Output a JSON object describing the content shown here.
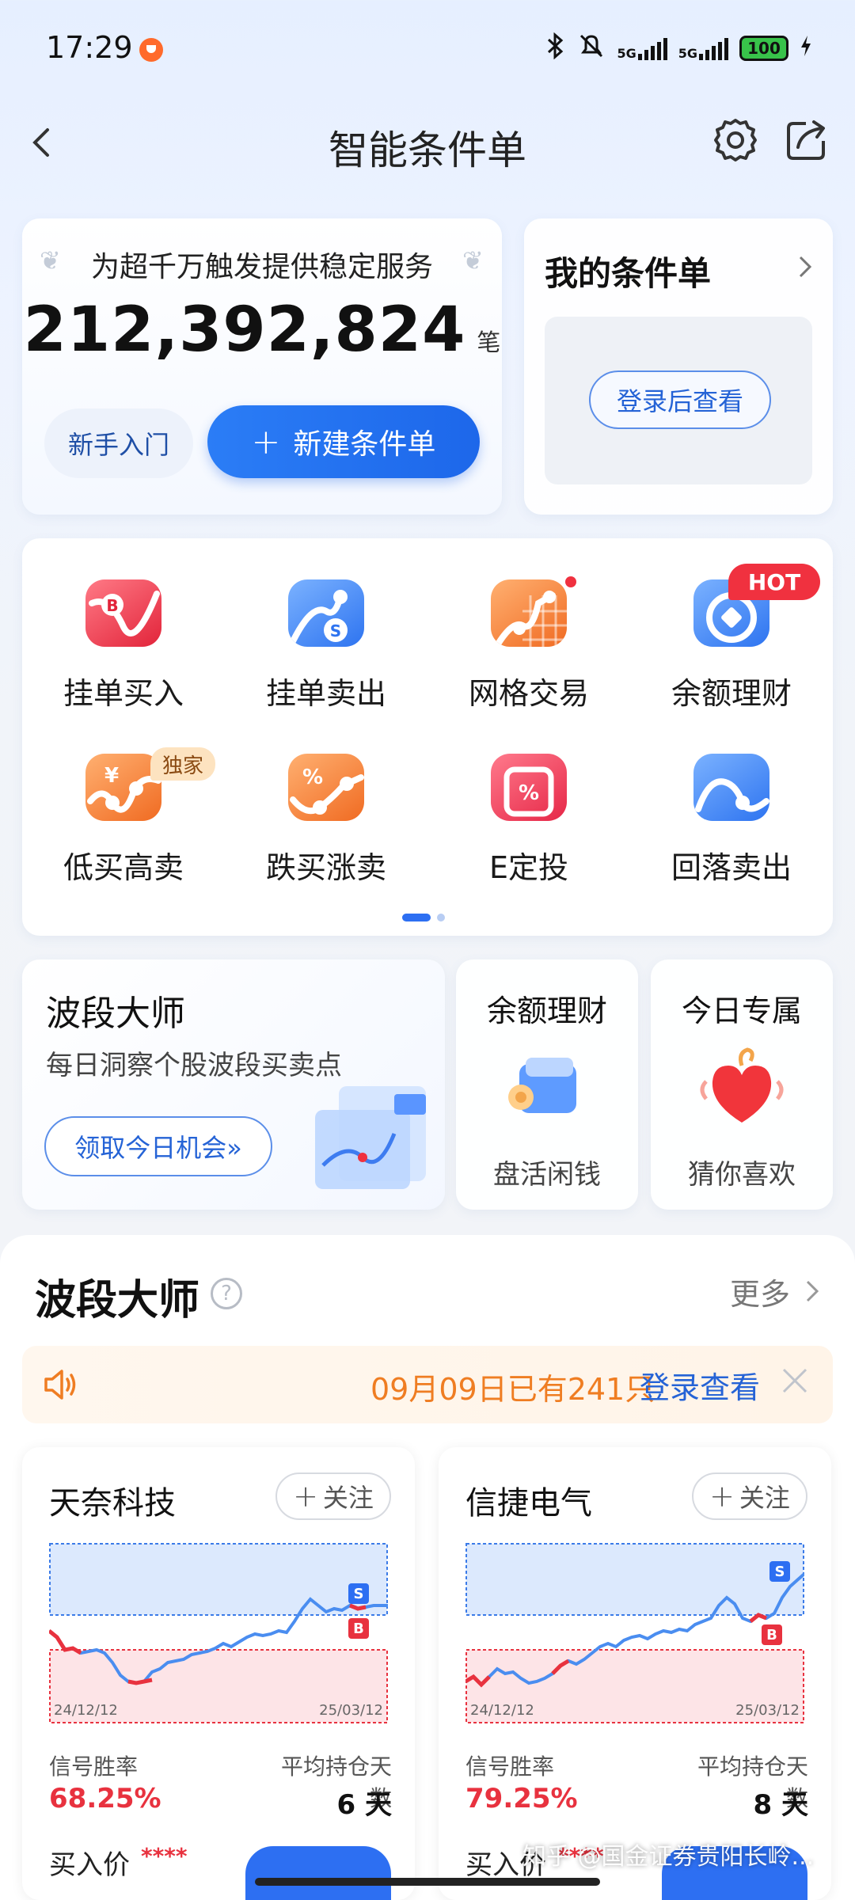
{
  "status": {
    "time": "17:29",
    "battery": "100",
    "net1": "5G",
    "net2": "5G"
  },
  "header": {
    "title": "智能条件单"
  },
  "stats_card": {
    "subtitle": "为超千万触发提供稳定服务",
    "count": "212,392,824",
    "unit": "笔",
    "guide_label": "新手入门",
    "create_label": "新建条件单",
    "create_icon": "+"
  },
  "my_card": {
    "title": "我的条件单",
    "login_label": "登录后查看"
  },
  "grid": {
    "items": [
      {
        "label": "挂单买入",
        "icon": "buy-order-icon",
        "color": "#e2243a"
      },
      {
        "label": "挂单卖出",
        "icon": "sell-order-icon",
        "color": "#2e74f0"
      },
      {
        "label": "网格交易",
        "icon": "grid-trade-icon",
        "color": "#f06b22"
      },
      {
        "label": "余额理财",
        "icon": "balance-wealth-icon",
        "color": "#2e74f0"
      },
      {
        "label": "低买高卖",
        "icon": "low-buy-high-sell-icon",
        "color": "#f06b22"
      },
      {
        "label": "跌买涨卖",
        "icon": "dip-buy-rise-sell-icon",
        "color": "#f06b22"
      },
      {
        "label": "E定投",
        "icon": "e-invest-icon",
        "color": "#e62747"
      },
      {
        "label": "回落卖出",
        "icon": "pullback-sell-icon",
        "color": "#2e74f0"
      }
    ],
    "hot_badge": "HOT",
    "exclusive_badge": "独家"
  },
  "promos": {
    "wave": {
      "title": "波段大师",
      "subtitle": "每日洞察个股波段买卖点",
      "button": "领取今日机会»"
    },
    "balance": {
      "title": "余额理财",
      "bottom": "盘活闲钱"
    },
    "today": {
      "title": "今日专属",
      "bottom": "猜你喜欢"
    }
  },
  "section": {
    "title": "波段大师",
    "more": "更多",
    "help_icon": "?"
  },
  "notice": {
    "text": "09月09日已有241只",
    "link": "登录查看"
  },
  "stocks": [
    {
      "name": "天奈科技",
      "follow": "关注",
      "date_start": "24/12/12",
      "date_end": "25/03/12",
      "win_rate_label": "信号胜率",
      "win_rate": "68.25%",
      "hold_label": "平均持仓天数",
      "hold_days": "6 天",
      "buy_label": "买入价",
      "buy_value": "****",
      "sell_marker": "S",
      "buy_marker": "B"
    },
    {
      "name": "信捷电气",
      "follow": "关注",
      "date_start": "24/12/12",
      "date_end": "25/03/12",
      "win_rate_label": "信号胜率",
      "win_rate": "79.25%",
      "hold_label": "平均持仓天数",
      "hold_days": "8 天",
      "buy_label": "买入价",
      "buy_value": "****",
      "sell_marker": "S",
      "buy_marker": "B"
    }
  ],
  "watermark": "知乎 @国金证券贵阳长岭..."
}
